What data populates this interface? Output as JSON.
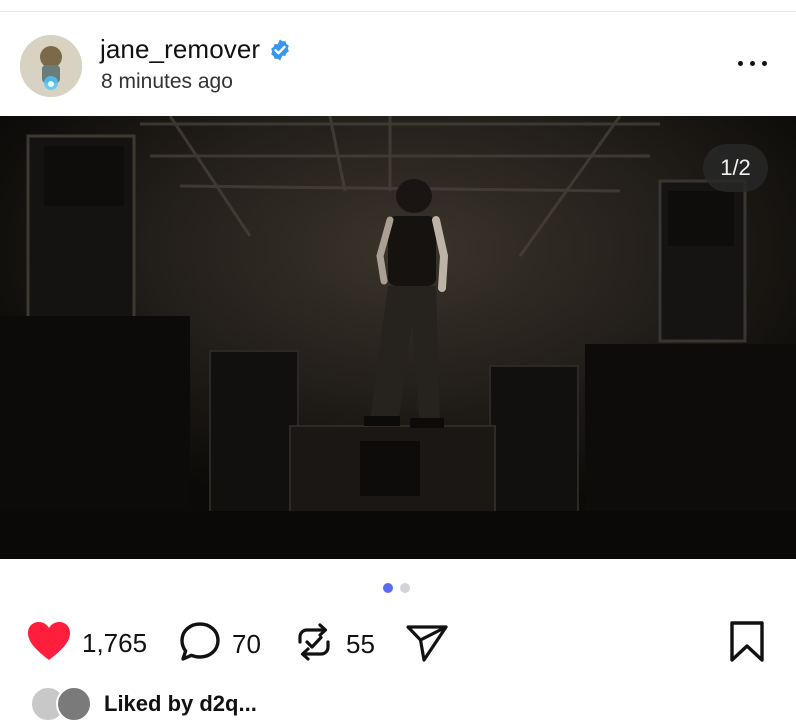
{
  "post": {
    "username": "jane_remover",
    "timestamp": "8 minutes ago",
    "verified_icon": "verified-badge-icon",
    "more_icon": "more-horizontal-icon",
    "media_counter": "1/2",
    "carousel": {
      "total": 2,
      "active": 1
    }
  },
  "actions": {
    "likes": "1,765",
    "comments": "70",
    "reposts": "55",
    "like_icon": "heart-filled-icon",
    "comment_icon": "comment-bubble-icon",
    "repost_icon": "repost-icon",
    "share_icon": "send-icon",
    "bookmark_icon": "bookmark-icon"
  },
  "liked_by": {
    "text": "Liked by d2q..."
  },
  "colors": {
    "accent_blue": "#5a6bf0",
    "like_red": "#ff1f3d",
    "verified_blue": "#3897f0"
  }
}
